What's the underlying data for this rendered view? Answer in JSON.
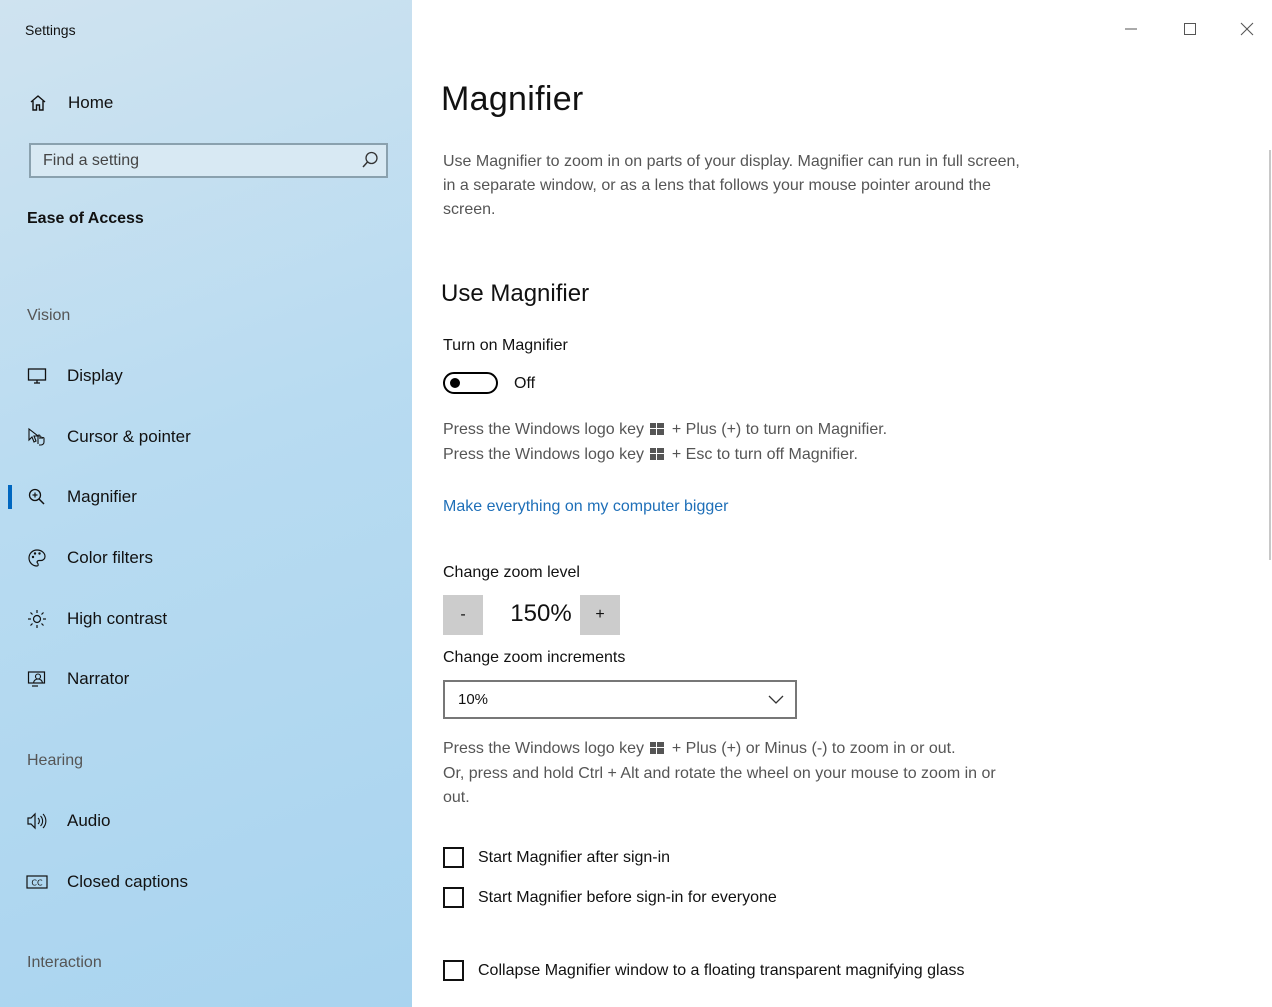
{
  "window": {
    "title": "Settings"
  },
  "sidebar": {
    "home_label": "Home",
    "search_placeholder": "Find a setting",
    "section": "Ease of Access",
    "groups": {
      "vision": "Vision",
      "hearing": "Hearing",
      "interaction": "Interaction"
    },
    "items": [
      {
        "label": "Display",
        "icon": "monitor-icon"
      },
      {
        "label": "Cursor & pointer",
        "icon": "cursor-pointer-icon"
      },
      {
        "label": "Magnifier",
        "icon": "zoom-in-icon",
        "active": true
      },
      {
        "label": "Color filters",
        "icon": "palette-icon"
      },
      {
        "label": "High contrast",
        "icon": "sun-icon"
      },
      {
        "label": "Narrator",
        "icon": "narrator-icon"
      },
      {
        "label": "Audio",
        "icon": "speaker-icon"
      },
      {
        "label": "Closed captions",
        "icon": "cc-icon"
      }
    ],
    "accent_color": "#0067c0"
  },
  "main": {
    "title": "Magnifier",
    "description": "Use Magnifier to zoom in on parts of your display. Magnifier can run in full screen, in a separate window, or as a lens that follows your mouse pointer around the screen.",
    "use_heading": "Use Magnifier",
    "turn_on_label": "Turn on Magnifier",
    "toggle_state": "Off",
    "hint_on_before": "Press the Windows logo key",
    "hint_on_after": "+ Plus (+) to turn on Magnifier.",
    "hint_off_before": "Press the Windows logo key",
    "hint_off_after": "+ Esc to turn off Magnifier.",
    "bigger_link": "Make everything on my computer bigger",
    "zoom_level_label": "Change zoom level",
    "zoom_minus": "-",
    "zoom_value": "150%",
    "zoom_plus": "+",
    "zoom_increments_label": "Change zoom increments",
    "zoom_increment_selected": "10%",
    "zoom_hint_1_before": "Press the Windows logo key",
    "zoom_hint_1_after": "+ Plus (+) or Minus (-) to zoom in or out.",
    "zoom_hint_2": "Or, press and hold Ctrl + Alt and rotate the wheel on your mouse to zoom in or out.",
    "checkboxes": [
      {
        "label": "Start Magnifier after sign-in",
        "checked": false
      },
      {
        "label": "Start Magnifier before sign-in for everyone",
        "checked": false
      },
      {
        "label": "Collapse Magnifier window to a floating transparent magnifying glass",
        "checked": false
      }
    ],
    "link_color": "#1e6fb8"
  }
}
